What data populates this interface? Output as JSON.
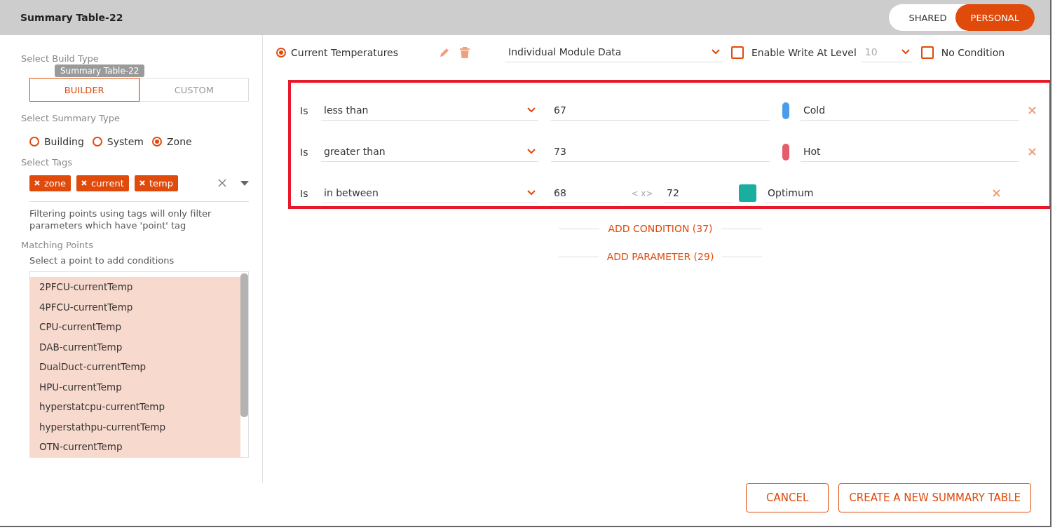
{
  "window": {
    "title": "Summary Table-22"
  },
  "scope_toggle": [
    {
      "label": "SHARED",
      "selected": false
    },
    {
      "label": "PERSONAL",
      "selected": true
    }
  ],
  "sidebar": {
    "build_type_label": "Select Build Type",
    "tooltip": "Summary Table-22",
    "build_tabs": [
      {
        "label": "BUILDER",
        "selected": true
      },
      {
        "label": "CUSTOM",
        "selected": false
      }
    ],
    "summary_type_label": "Select Summary Type",
    "summary_types": [
      {
        "label": "Building",
        "selected": false
      },
      {
        "label": "System",
        "selected": false
      },
      {
        "label": "Zone",
        "selected": true
      }
    ],
    "tags_label": "Select Tags",
    "tags": [
      "zone",
      "current",
      "temp"
    ],
    "tags_note": "Filtering points using tags will only filter parameters which have 'point' tag",
    "matching_label": "Matching Points",
    "matching_hint": "Select a point to add conditions",
    "points": [
      "2PFCU-currentTemp",
      "4PFCU-currentTemp",
      "CPU-currentTemp",
      "DAB-currentTemp",
      "DualDuct-currentTemp",
      "HPU-currentTemp",
      "hyperstatcpu-currentTemp",
      "hyperstathpu-currentTemp",
      "OTN-currentTemp"
    ]
  },
  "parameter": {
    "name": "Current Temperatures",
    "selected": true,
    "data_source": "Individual Module Data",
    "enable_write": {
      "label": "Enable Write At Level",
      "checked": false,
      "level_value": "10"
    },
    "no_condition": {
      "label": "No Condition",
      "checked": false
    },
    "conditions": [
      {
        "kind": "single",
        "prefix": "Is",
        "operator": "less than",
        "value": "67",
        "color": "#4a9be8",
        "label": "Cold"
      },
      {
        "kind": "single",
        "prefix": "Is",
        "operator": "greater than",
        "value": "73",
        "color": "#e55d6a",
        "label": "Hot"
      },
      {
        "kind": "range",
        "prefix": "Is",
        "operator": "in between",
        "value": "68",
        "between": "< x>",
        "value_to": "72",
        "color": "#1aae9f",
        "label": "Optimum"
      }
    ]
  },
  "add_condition": "ADD CONDITION (37)",
  "add_parameter": "ADD PARAMETER (29)",
  "buttons": [
    "CANCEL",
    "CREATE A NEW SUMMARY TABLE"
  ]
}
